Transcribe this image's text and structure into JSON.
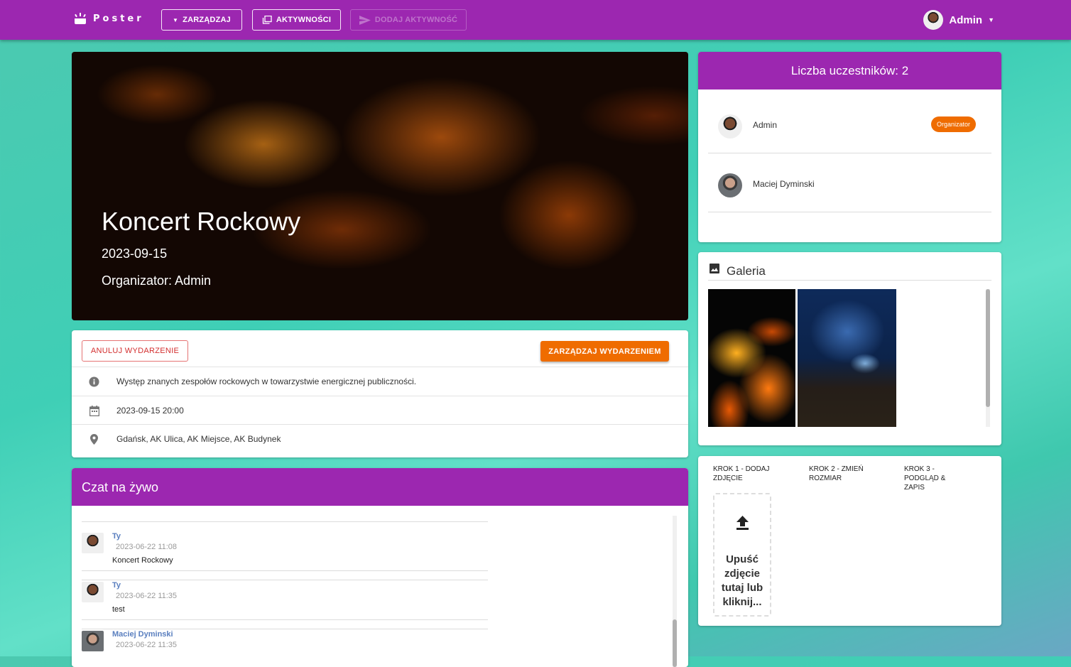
{
  "topbar": {
    "logo_text": "Poster",
    "buttons": [
      {
        "label": "ZARZĄDZAJ",
        "icon": "dropdown-arrow-icon"
      },
      {
        "label": "AKTYWNOŚCI",
        "icon": "collections-icon"
      },
      {
        "label": "DODAJ AKTYWNOŚĆ",
        "icon": "send-icon",
        "disabled": true
      }
    ],
    "user_name": "Admin"
  },
  "event": {
    "title": "Koncert Rockowy",
    "date": "2023-09-15",
    "organizer": "Organizator: Admin",
    "cancel_label": "ANULUJ WYDARZENIE",
    "manage_label": "ZARZĄDZAJ WYDARZENIEM",
    "details": [
      {
        "icon": "info-icon",
        "text": "Występ znanych zespołów rockowych w towarzystwie energicznej publiczności."
      },
      {
        "icon": "calendar-icon",
        "text": "2023-09-15 20:00"
      },
      {
        "icon": "location-pin-icon",
        "text": "Gdańsk, AK Ulica, AK Miejsce, AK Budynek"
      }
    ]
  },
  "chat": {
    "title": "Czat na żywo",
    "messages": [
      {
        "name": "Ty",
        "time": "2023-06-22 11:08",
        "text": "Koncert Rockowy"
      },
      {
        "name": "Ty",
        "time": "2023-06-22 11:35",
        "text": "test"
      },
      {
        "name": "Maciej Dyminski",
        "time": "2023-06-22 11:35",
        "text": ""
      }
    ]
  },
  "participants": {
    "title": "Liczba uczestników: 2",
    "list": [
      {
        "name": "Admin",
        "badge": "Organizator"
      },
      {
        "name": "Maciej Dyminski",
        "badge": ""
      }
    ]
  },
  "gallery": {
    "title": "Galeria",
    "icon": "image-icon"
  },
  "upload": {
    "steps": [
      "KROK 1 - DODAJ ZDJĘCIE",
      "KROK 2 - ZMIEŃ ROZMIAR",
      "KROK 3 - PODGLĄD & ZAPIS"
    ],
    "drop_text": "Upuść zdjęcie tutaj lub kliknij..."
  },
  "colors": {
    "primary": "#9c27b0",
    "accent": "#ef6c00",
    "danger": "#d32f2f"
  }
}
